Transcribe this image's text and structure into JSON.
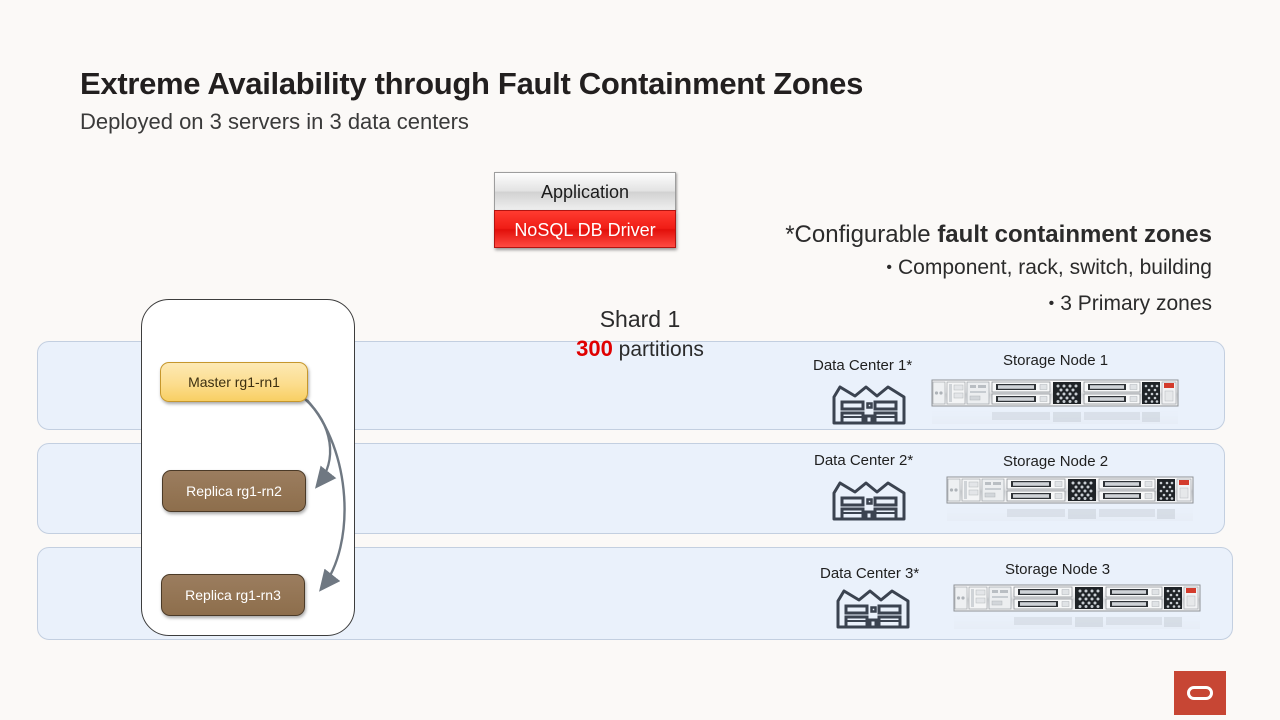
{
  "slide": {
    "title": "Extreme Availability through Fault Containment Zones",
    "subtitle": "Deployed on 3 servers in 3 data centers",
    "background_color": "#FBF9F7"
  },
  "app_stack": {
    "application_label": "Application",
    "driver_label": "NoSQL DB Driver",
    "driver_color": "#ED1C16"
  },
  "notes": {
    "heading_prefix": "*Configurable ",
    "heading_bold": "fault containment zones",
    "bullets": [
      "Component, rack, switch, building",
      "3 Primary zones"
    ],
    "bullet_glyph": "•"
  },
  "shard": {
    "title": "Shard  1",
    "partitions_count": "300",
    "partitions_label": " partitions",
    "count_color": "#E00000",
    "nodes": [
      {
        "role": "Master",
        "name": "rg1-rn1",
        "label": "Master  rg1-rn1",
        "color": "#F8CF63"
      },
      {
        "role": "Replica",
        "name": "rg1-rn2",
        "label": "Replica rg1-rn2",
        "color": "#937453"
      },
      {
        "role": "Replica",
        "name": "rg1-rn3",
        "label": "Replica rg1-rn3",
        "color": "#937453"
      }
    ]
  },
  "rows": [
    {
      "data_center": "Data Center 1*",
      "storage_node": "Storage Node 1"
    },
    {
      "data_center": "Data Center 2*",
      "storage_node": "Storage Node 2"
    },
    {
      "data_center": "Data Center 3*",
      "storage_node": "Storage Node 3"
    }
  ],
  "band_color": "#EAF1FB",
  "logo": {
    "name": "oracle-logo",
    "color": "#C74634"
  }
}
